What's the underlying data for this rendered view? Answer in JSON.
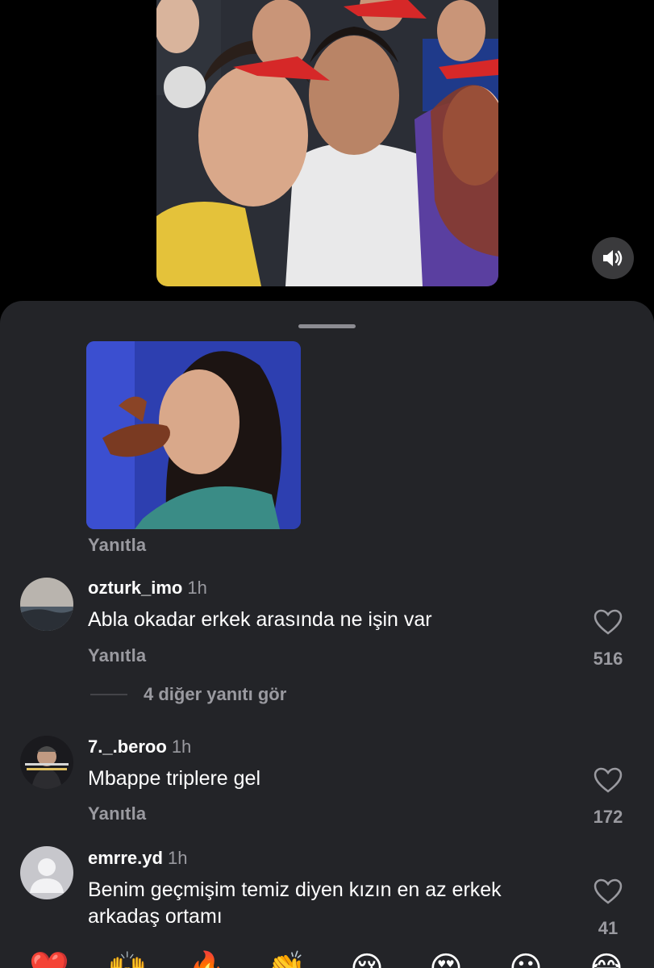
{
  "video": {
    "sound_icon": "speaker-icon"
  },
  "sheet": {
    "gif_reply_label": "Yanıtla",
    "comments": [
      {
        "username": "ozturk_imo",
        "time": "1h",
        "text": "Abla okadar erkek arasında ne işin var",
        "reply_label": "Yanıtla",
        "likes": "516",
        "more_replies": "4 diğer yanıtı gör"
      },
      {
        "username": "7._.beroo",
        "time": "1h",
        "text": "Mbappe triplere gel",
        "reply_label": "Yanıtla",
        "likes": "172"
      },
      {
        "username": "emrre.yd",
        "time": "1h",
        "text": "Benim geçmişim temiz diyen kızın en az erkek arkadaş ortamı",
        "likes": "41"
      }
    ]
  },
  "emoji_bar": [
    "❤️",
    "🙌",
    "🔥",
    "👏",
    "😢",
    "😍",
    "😮",
    "😂"
  ]
}
